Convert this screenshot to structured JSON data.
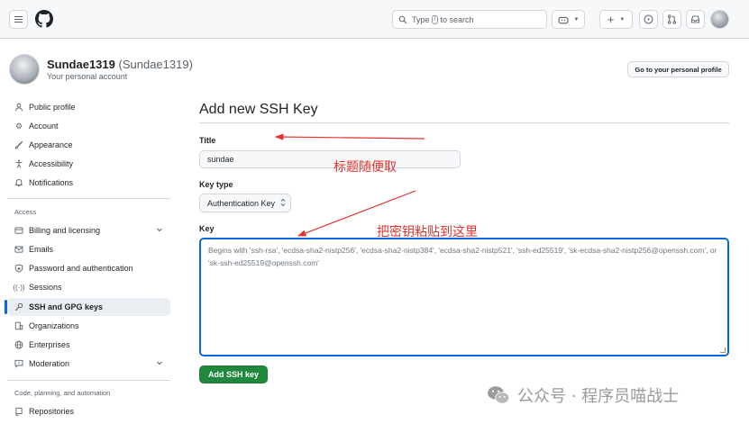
{
  "header": {
    "search_text": "Type",
    "search_key": "/",
    "search_suffix": "to search",
    "plus_label": "+"
  },
  "profile": {
    "name": "Sundae1319",
    "login": "(Sundae1319)",
    "subtitle": "Your personal account",
    "profile_button": "Go to your personal profile"
  },
  "sidebar": {
    "items_top": [
      {
        "label": "Public profile",
        "icon": "person-icon"
      },
      {
        "label": "Account",
        "icon": "gear-icon"
      },
      {
        "label": "Appearance",
        "icon": "paintbrush-icon"
      },
      {
        "label": "Accessibility",
        "icon": "accessibility-icon"
      },
      {
        "label": "Notifications",
        "icon": "bell-icon"
      }
    ],
    "group_access": "Access",
    "items_access": [
      {
        "label": "Billing and licensing",
        "icon": "credit-card-icon"
      },
      {
        "label": "Emails",
        "icon": "mail-icon"
      },
      {
        "label": "Password and authentication",
        "icon": "shield-lock-icon"
      },
      {
        "label": "Sessions",
        "icon": "broadcast-icon"
      },
      {
        "label": "SSH and GPG keys",
        "icon": "key-icon"
      },
      {
        "label": "Organizations",
        "icon": "organization-icon"
      },
      {
        "label": "Enterprises",
        "icon": "globe-icon"
      },
      {
        "label": "Moderation",
        "icon": "report-icon"
      }
    ],
    "group_code": "Code, planning, and automation",
    "items_code": [
      {
        "label": "Repositories",
        "icon": "repo-icon"
      }
    ]
  },
  "main": {
    "title": "Add new SSH Key",
    "title_label": "Title",
    "title_value": "sundae",
    "key_type_label": "Key type",
    "key_type_value": "Authentication Key",
    "key_label": "Key",
    "key_placeholder": "Begins with 'ssh-rsa', 'ecdsa-sha2-nistp256', 'ecdsa-sha2-nistp384', 'ecdsa-sha2-nistp521', 'ssh-ed25519', 'sk-ecdsa-sha2-nistp256@openssh.com', or 'sk-ssh-ed25519@openssh.com'",
    "submit_label": "Add SSH key"
  },
  "annotations": {
    "title_note": "标题随便取",
    "key_note": "把密钥粘贴到这里",
    "color": "#e5322d"
  },
  "watermark": {
    "text": "公众号 · 程序员喵战士"
  },
  "colors": {
    "accent": "#0969da",
    "primary_button": "#1f883d"
  }
}
